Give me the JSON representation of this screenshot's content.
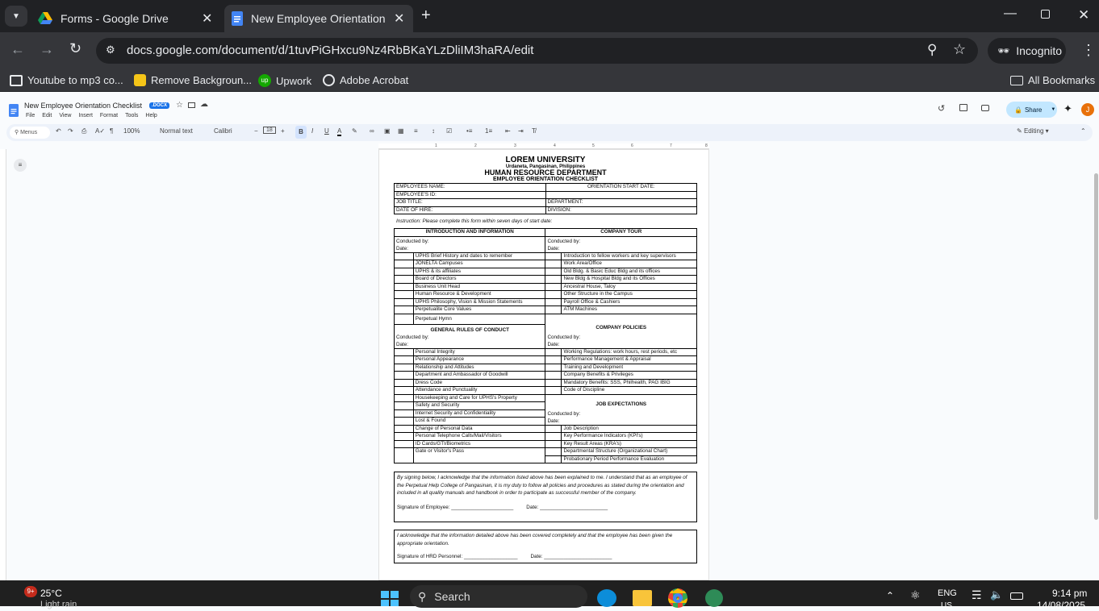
{
  "browser": {
    "tabs": [
      {
        "title": "Forms - Google Drive",
        "active": false
      },
      {
        "title": "New Employee Orientation Che",
        "active": true
      }
    ],
    "url": "docs.google.com/document/d/1tuvPiGHxcu9Nz4RbBKaYLzDliIM3haRA/edit",
    "profile_label": "Incognito",
    "bookmarks": [
      "Youtube to mp3 co...",
      "Remove Backgroun...",
      "Upwork",
      "Adobe Acrobat"
    ],
    "all_bookmarks": "All Bookmarks"
  },
  "docs": {
    "doc_title": "New Employee Orientation Checklist",
    "badge": ".DOCX",
    "menu": [
      "File",
      "Edit",
      "View",
      "Insert",
      "Format",
      "Tools",
      "Help"
    ],
    "share_label": "Share",
    "avatar_letter": "J",
    "toolbar": {
      "search": "Menus",
      "zoom": "100%",
      "style": "Normal text",
      "font": "Calibri",
      "font_size": "18",
      "mode": "Editing"
    },
    "ruler_numbers": [
      "1",
      "2",
      "3",
      "4",
      "5",
      "6",
      "7",
      "8"
    ]
  },
  "document": {
    "university": "LOREM UNIVERSITY",
    "location": "Urdaneta, Pangasinan, Philippines",
    "department": "HUMAN RESOURCE DEPARTMENT",
    "form_title": "EMPLOYEE ORIENTATION CHECKLIST",
    "info": {
      "left": [
        "EMPLOYEES NAME:",
        "EMPLOYEE'S ID:",
        "JOB TITLE:",
        "DATE OF HIRE:"
      ],
      "right": [
        "ORIENTATION START DATE:",
        "",
        "DEPARTMENT:",
        "DIVISION:"
      ]
    },
    "instruction": "Instruction: Please complete this form within seven days of start date:",
    "conducted": "Conducted by:",
    "date": "Date:",
    "sec1": {
      "left_title": "INTRODUCTION AND INFORMATION",
      "right_title": "COMPANY TOUR",
      "left_items": [
        "UPHS Brief History and dates to remember",
        "JONELTA Campuses",
        "UPHS & its affiliates",
        "Board of Directors",
        "Business Unit Head",
        "Human Resource & Development",
        "UPHS Philosophy, Vision & Mission Statements",
        "Perpetualite Core Values",
        "Perpetual Hymn"
      ],
      "right_items": [
        "Introduction to fellow workers and key supervisors",
        "Work Area/Office",
        "Old Bldg. & Basic Educ Bldg and its offices",
        "New Bldg & Hospital Bldg and its Offices",
        "Ancestral House, Taloy",
        "Other Structure in the Campus",
        "Payroll Office & Cashiers",
        "ATM Machines"
      ]
    },
    "sec2": {
      "left_title": "GENERAL RULES OF CONDUCT",
      "right_title": "COMPANY POLICIES",
      "left_items": [
        "Personal Integrity",
        "Personal Appearance",
        "Relationship and Attitudes",
        "Department and Ambassador of Goodwill",
        "Dress Code",
        "Attendance and Punctuality",
        "Housekeeping and Care for UPHS's Property",
        "Safety and Security",
        "Internet Security and Confidentiality",
        "Lost & Found",
        "Change of Personal Data",
        "Personal Telephone Calls/Mail/Visitors",
        "ID Cards/GTI/Biometrics",
        "Gate or Visitor's Pass"
      ],
      "right_items": [
        "Working Regulations: work hours, rest periods, etc",
        "Performance Management & Appraisal",
        "Training and Development",
        "Company Benefits & Privileges",
        "Mandatory Benefits: SSS, Philhealth, PAG IBIG",
        "Code of Discipline"
      ],
      "right_title_2": "JOB EXPECTATIONS",
      "right_items_2": [
        "Job Description",
        "Key Performance Indicators (KPI's)",
        "Key Result Areas (KRA's)",
        "Departmental Structure (Organizational Chart)",
        "Probationary Period Performance Evaluation"
      ]
    },
    "ack1": "By signing below, I acknowledge that the information listed above has been explained to me. I understand that as an employee of the Perpetual Help College of Pangasinan, it is my duty to follow all policies and procedures as stated during the orientation and included in all quality manuals and handbook in order to participate as successful member of the company.",
    "sig_employee": "Signature of Employee: ______________________",
    "sig_date": "Date: ________________________",
    "ack2": "I acknowledge that the information detailed above has been covered completely and that the employee has been given the appropriate orientation.",
    "sig_hrd": "Signature of HRD Personnel: ___________________"
  },
  "taskbar": {
    "weather_temp": "25°C",
    "weather_desc": "Light rain",
    "weather_badge": "9+",
    "search": "Search",
    "lang": "ENG",
    "lang_sub": "US",
    "time": "9:14 pm",
    "date": "14/08/2025"
  }
}
